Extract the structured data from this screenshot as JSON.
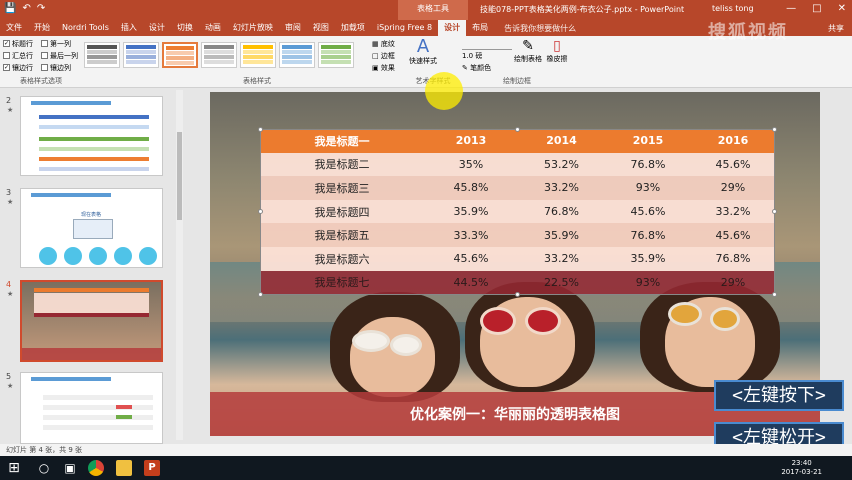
{
  "titlebar": {
    "context_tab": "表格工具",
    "doc_title": "技能078-PPT表格美化两例-布衣公子.pptx - PowerPoint",
    "user": "teliss tong"
  },
  "tabs": [
    "文件",
    "开始",
    "Nordri Tools",
    "插入",
    "设计",
    "切换",
    "动画",
    "幻灯片放映",
    "审阅",
    "视图",
    "加载项",
    "iSpring Free 8",
    "设计",
    "布局"
  ],
  "active_tab_index": 12,
  "tell_me": "告诉我你想要做什么",
  "share": "共享",
  "ribbon": {
    "options": [
      "标题行",
      "第一列",
      "汇总行",
      "最后一列",
      "镶边行",
      "镶边列"
    ],
    "options_checked": [
      true,
      false,
      false,
      false,
      true,
      false
    ],
    "options_label": "表格样式选项",
    "styles_label": "表格样式",
    "shading": "底纹",
    "border": "边框",
    "effects": "效果",
    "quick_styles": "快速样式",
    "art_label": "艺术字样式",
    "pen_weight": "1.0 磅",
    "pen_color": "笔颜色",
    "draw_table": "绘制表格",
    "eraser": "橡皮擦",
    "draw_label": "绘制边框"
  },
  "slides": [
    {
      "num": "2",
      "star": "★"
    },
    {
      "num": "3",
      "star": "★"
    },
    {
      "num": "4",
      "star": "★"
    },
    {
      "num": "5",
      "star": "★"
    }
  ],
  "slide3_title": "现在表格",
  "table": {
    "header": [
      "我是标题一",
      "2013",
      "2014",
      "2015",
      "2016"
    ],
    "rows": [
      [
        "我是标题二",
        "35%",
        "53.2%",
        "76.8%",
        "45.6%"
      ],
      [
        "我是标题三",
        "45.8%",
        "33.2%",
        "93%",
        "29%"
      ],
      [
        "我是标题四",
        "35.9%",
        "76.8%",
        "45.6%",
        "33.2%"
      ],
      [
        "我是标题五",
        "33.3%",
        "35.9%",
        "76.8%",
        "45.6%"
      ],
      [
        "我是标题六",
        "45.6%",
        "33.2%",
        "35.9%",
        "76.8%"
      ],
      [
        "我是标题七",
        "44.5%",
        "22.5%",
        "93%",
        "29%"
      ]
    ]
  },
  "banner": "优化案例一：华丽丽的透明表格图",
  "key_overlay": [
    "<左键按下>",
    "<左键松开>"
  ],
  "watermark": "搜狐视频",
  "status": "幻灯片 第 4 张，共 9 张",
  "clock": {
    "time": "23:40",
    "date": "2017-03-21"
  },
  "icons": [
    "save-icon",
    "undo-icon",
    "redo-icon",
    "start-icon",
    "chrome-icon",
    "folder-icon",
    "powerpoint-icon"
  ],
  "colors": {
    "accent": "#b7472a",
    "header_orange": "#ec7b2e",
    "last_row": "#962832"
  }
}
